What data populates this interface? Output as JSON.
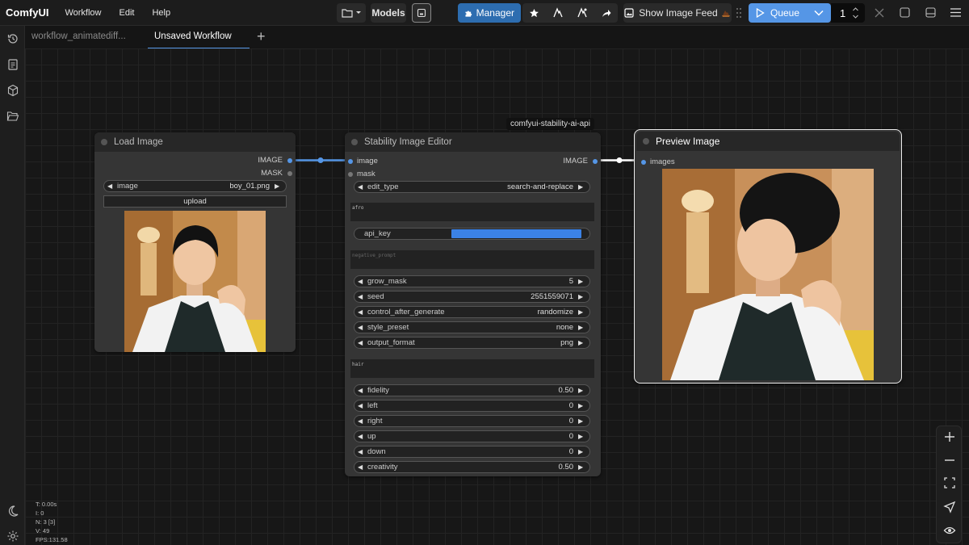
{
  "app": {
    "logo": "ComfyUI",
    "menu": [
      "Workflow",
      "Edit",
      "Help"
    ]
  },
  "toolbar": {
    "models_label": "Models",
    "manager_label": "Manager",
    "image_feed_label": "Show Image Feed",
    "queue_label": "Queue",
    "queue_count": "1"
  },
  "tabs": [
    {
      "label": "workflow_animatediff..."
    },
    {
      "label": "Unsaved Workflow",
      "modified_marker": "●"
    }
  ],
  "tab_add": "+",
  "nodes": {
    "load_image": {
      "title": "Load Image",
      "outputs": [
        "IMAGE",
        "MASK"
      ],
      "image_widget": {
        "label": "image",
        "value": "boy_01.png"
      },
      "upload_label": "upload"
    },
    "editor": {
      "title": "Stability Image Editor",
      "badge": "comfyui-stability-ai-api",
      "inputs": [
        "image",
        "mask"
      ],
      "output": "IMAGE",
      "widgets": {
        "edit_type": {
          "label": "edit_type",
          "value": "search-and-replace"
        },
        "prompt": "afro",
        "api_key": {
          "label": "api_key"
        },
        "negative_prompt_placeholder": "negative_prompt",
        "grow_mask": {
          "label": "grow_mask",
          "value": "5"
        },
        "seed": {
          "label": "seed",
          "value": "2551559071"
        },
        "control_after_generate": {
          "label": "control_after_generate",
          "value": "randomize"
        },
        "style_preset": {
          "label": "style_preset",
          "value": "none"
        },
        "output_format": {
          "label": "output_format",
          "value": "png"
        },
        "search_prompt": "hair",
        "fidelity": {
          "label": "fidelity",
          "value": "0.50"
        },
        "left": {
          "label": "left",
          "value": "0"
        },
        "right": {
          "label": "right",
          "value": "0"
        },
        "up": {
          "label": "up",
          "value": "0"
        },
        "down": {
          "label": "down",
          "value": "0"
        },
        "creativity": {
          "label": "creativity",
          "value": "0.50"
        }
      }
    },
    "preview": {
      "title": "Preview Image",
      "input": "images"
    }
  },
  "stats": {
    "t": "T: 0.00s",
    "i": "I: 0",
    "n": "N: 3 [3]",
    "v": "V: 49",
    "fps": "FPS:131.58"
  },
  "colors": {
    "accent": "#5596e6",
    "manager": "#2d6db0",
    "background": "#151515",
    "node": "#353535"
  }
}
